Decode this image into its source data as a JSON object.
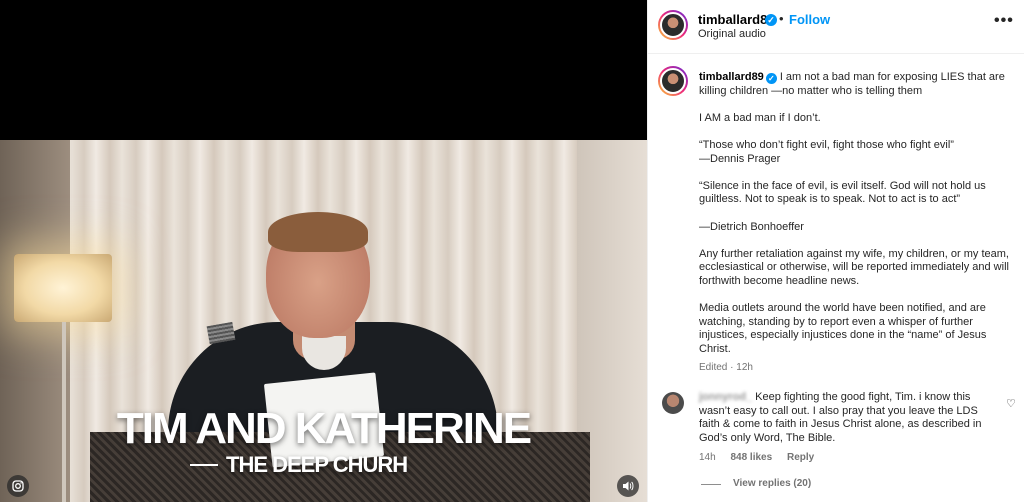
{
  "video": {
    "title": "TIM AND KATHERINE",
    "subtitle": "THE DEEP CHURH",
    "left_control_icon": "instagram-icon",
    "right_control_icon": "volume-icon"
  },
  "header": {
    "username": "timballard89",
    "follow_separator": "•",
    "follow_label": "Follow",
    "audio_label": "Original audio",
    "more_label": "•••"
  },
  "caption": {
    "username": "timballard89",
    "paragraphs": [
      "I am not a bad man for exposing LIES that are killing children —no matter who is telling them",
      "I AM a bad man if I don’t.",
      "“Those who don’t fight evil, fight those who fight evil”\n—Dennis Prager",
      "“Silence in the face of evil, is evil itself. God will not hold us guiltless. Not to speak is to speak. Not to act is to act”",
      "—Dietrich Bonhoeffer",
      "Any further retaliation against my wife, my children, or my team, ecclesiastical or otherwise, will be reported immediately and will forthwith become headline news.",
      "Media outlets around the world have been notified, and are watching, standing by to report even a whisper of further injustices, especially injustices done in the “name” of Jesus Christ."
    ],
    "edited_label": "Edited",
    "edited_separator": "·",
    "edited_time": "12h"
  },
  "comment": {
    "username": "jonnyrod_",
    "text": "Keep fighting the good fight, Tim. i know this wasn’t easy to call out. I also pray that you leave the LDS faith & come to faith in Jesus Christ alone, as described in God’s only Word, The Bible.",
    "time": "14h",
    "likes": "848 likes",
    "reply_label": "Reply",
    "view_replies": "View replies (20)"
  },
  "colors": {
    "accent": "#0095f6",
    "secondary_text": "#737373"
  }
}
